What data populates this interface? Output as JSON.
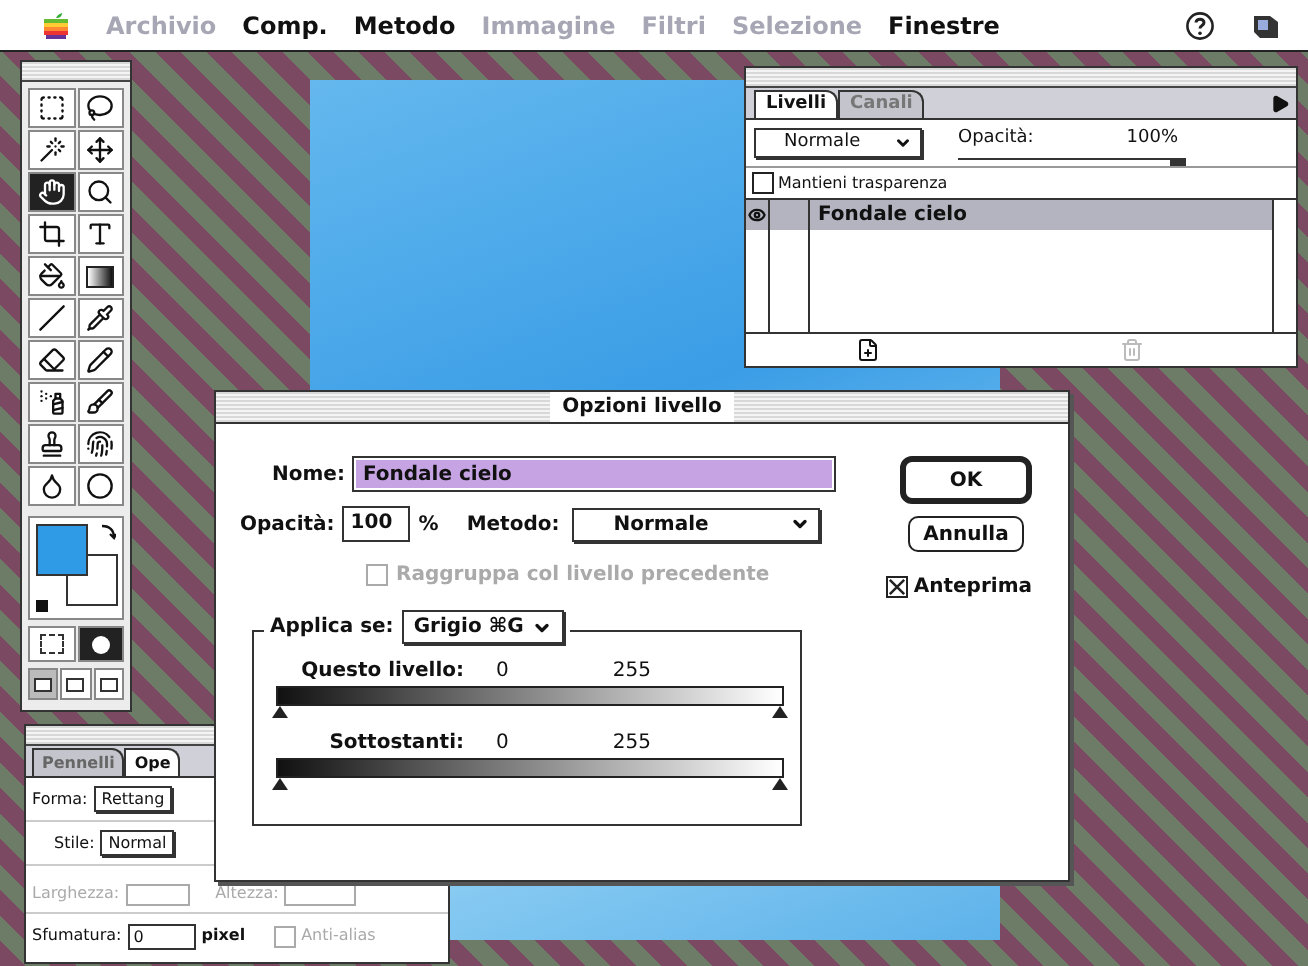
{
  "menu_bar": {
    "items": [
      {
        "label": "Archivio",
        "disabled": true
      },
      {
        "label": "Comp.",
        "disabled": false
      },
      {
        "label": "Metodo",
        "disabled": false
      },
      {
        "label": "Immagine",
        "disabled": true
      },
      {
        "label": "Filtri",
        "disabled": true
      },
      {
        "label": "Selezione",
        "disabled": true
      },
      {
        "label": "Finestre",
        "disabled": false
      }
    ]
  },
  "toolbox": {
    "tools": [
      {
        "selected": false
      },
      {
        "selected": false
      },
      {
        "selected": false
      },
      {
        "selected": false
      },
      {
        "selected": true
      },
      {
        "selected": false
      },
      {
        "selected": false
      },
      {
        "selected": false
      },
      {
        "selected": false
      },
      {
        "selected": false
      },
      {
        "selected": false
      },
      {
        "selected": false
      },
      {
        "selected": false
      },
      {
        "selected": false
      },
      {
        "selected": false
      },
      {
        "selected": false
      },
      {
        "selected": false
      },
      {
        "selected": false
      },
      {
        "selected": false
      },
      {
        "selected": false
      }
    ]
  },
  "layers_panel": {
    "tabs": [
      {
        "label": "Livelli",
        "selected": true
      },
      {
        "label": "Canali",
        "selected": false
      }
    ],
    "blend_mode": "Normale",
    "opacity_label": "Opacità:",
    "opacity_value": "100%",
    "opacity_slider": {
      "level": 1
    },
    "preserve_transparency": {
      "label": "Mantieni trasparenza",
      "checked": false
    },
    "layers": [
      {
        "name": "Fondale cielo",
        "visible": true,
        "selected": true
      }
    ],
    "delete_disabled": true
  },
  "options_panel": {
    "tabs": [
      {
        "label": "Pennelli",
        "selected": false
      },
      {
        "label": "Ope",
        "selected": true
      }
    ],
    "shape_label": "Forma:",
    "shape_value": "Rettang",
    "style_label": "Stile:",
    "style_value": "Normal",
    "width_label": "Larghezza:",
    "height_label": "Altezza:",
    "size_disabled": true,
    "feather_label": "Sfumatura:",
    "feather_value": "0",
    "feather_unit": "pixel",
    "anti_alias": {
      "label": "Anti-alias",
      "checked": false,
      "disabled": true
    }
  },
  "dialog": {
    "title": "Opzioni livello",
    "name_label": "Nome:",
    "name_value": "Fondale cielo",
    "buttons": [
      {
        "label": "OK",
        "default": true
      },
      {
        "label": "Annulla",
        "default": false
      }
    ],
    "opacity_label": "Opacità:",
    "opacity_value": "100",
    "opacity_unit": "%",
    "mode_label": "Metodo:",
    "mode_value": "Normale",
    "group_checkbox": {
      "label": "Raggruppa col livello precedente",
      "checked": false,
      "disabled": true
    },
    "preview_checkbox": {
      "label": "Anteprima",
      "checked": true,
      "disabled": false
    },
    "blend_if_label": "Applica se:",
    "blend_if_value": "Grigio ⌘G",
    "ranges": [
      {
        "label": "Questo livello:",
        "low": "0",
        "high": "255"
      },
      {
        "label": "Sottostanti:",
        "low": "0",
        "high": "255"
      }
    ]
  }
}
